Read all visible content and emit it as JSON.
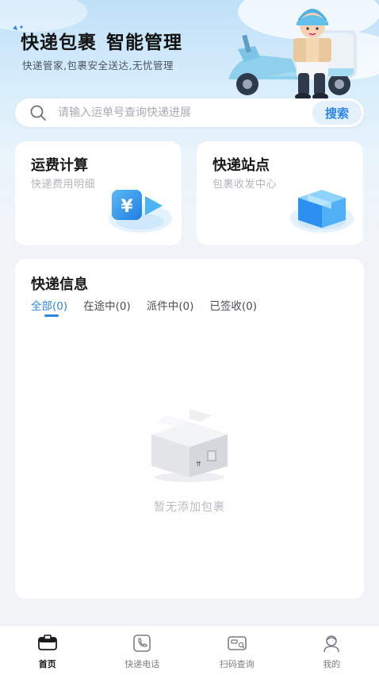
{
  "hero": {
    "title_part1": "快递包裹",
    "title_part2": "智能管理",
    "subtitle": "快递管家,包裹安全送达,无忧管理"
  },
  "search": {
    "placeholder": "请输入运单号查询快递进展",
    "button_label": "搜索"
  },
  "features": [
    {
      "title": "运费计算",
      "subtitle": "快递费用明细",
      "icon": "yuan-coin-icon"
    },
    {
      "title": "快递站点",
      "subtitle": "包裹收发中心",
      "icon": "parcel-box-icon"
    }
  ],
  "info": {
    "title": "快递信息",
    "tabs": [
      {
        "label": "全部(0)",
        "active": true
      },
      {
        "label": "在途中(0)",
        "active": false
      },
      {
        "label": "派件中(0)",
        "active": false
      },
      {
        "label": "已签收(0)",
        "active": false
      }
    ],
    "empty_text": "暂无添加包裹"
  },
  "tabbar": [
    {
      "label": "首页",
      "icon": "home-box-icon",
      "active": true
    },
    {
      "label": "快递电话",
      "icon": "phone-icon",
      "active": false
    },
    {
      "label": "扫码查询",
      "icon": "scan-icon",
      "active": false
    },
    {
      "label": "我的",
      "icon": "user-icon",
      "active": false
    }
  ],
  "colors": {
    "accent": "#2c86e6",
    "background": "#f2f3f7",
    "hero_sky": "#bfe0f8"
  }
}
